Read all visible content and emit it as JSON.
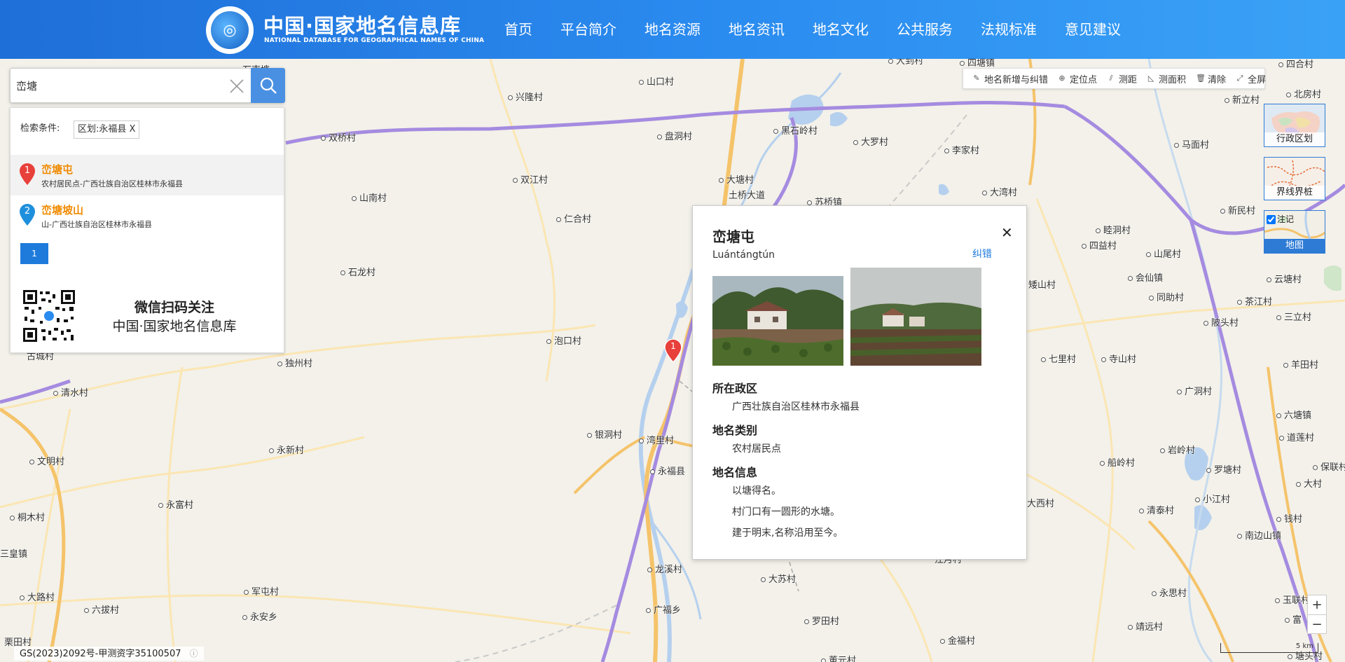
{
  "header": {
    "title": "中国·国家地名信息库",
    "subtitle": "NATIONAL DATABASE FOR GEOGRAPHICAL NAMES OF CHINA",
    "nav": [
      "首页",
      "平台简介",
      "地名资源",
      "地名资讯",
      "地名文化",
      "公共服务",
      "法规标准",
      "意见建议"
    ]
  },
  "search": {
    "value": "峦塘",
    "filter_label": "检索条件:",
    "filter_tag": "区划:永福县 X",
    "results": [
      {
        "index": "1",
        "name": "峦塘屯",
        "desc": "农村居民点-广西壮族自治区桂林市永福县"
      },
      {
        "index": "2",
        "name": "峦塘坡山",
        "desc": "山-广西壮族自治区桂林市永福县"
      }
    ],
    "page": "1",
    "qr_title": "微信扫码关注",
    "qr_sub": "中国·国家地名信息库"
  },
  "toolbar": {
    "items": [
      {
        "label": "地名新增与纠错",
        "icon": "edit-icon"
      },
      {
        "label": "定位点",
        "icon": "locate-icon"
      },
      {
        "label": "测距",
        "icon": "ruler-icon"
      },
      {
        "label": "测面积",
        "icon": "area-icon"
      },
      {
        "label": "清除",
        "icon": "trash-icon"
      },
      {
        "label": "全屏",
        "icon": "fullscreen-icon"
      }
    ]
  },
  "layers": {
    "admin": "行政区划",
    "boundary": "界线界桩",
    "map": "地图",
    "annotation": "注记",
    "annotation_checked": true
  },
  "popup": {
    "title": "峦塘屯",
    "pinyin": "Luántángtún",
    "correct": "纠错",
    "region_head": "所在政区",
    "region": "广西壮族自治区桂林市永福县",
    "type_head": "地名类别",
    "type": "农村居民点",
    "info_head": "地名信息",
    "info": [
      "以塘得名。",
      "村门口有一圆形的水塘。",
      "建于明末,名称沿用至今。"
    ]
  },
  "map": {
    "marker": "1",
    "scale": "5 km",
    "copyright": "GS(2023)2092号-甲测资字35100507",
    "places": [
      {
        "name": "石南塘",
        "style": "plain"
      },
      {
        "name": "大到村",
        "style": "dot"
      },
      {
        "name": "四塘镇",
        "style": "dot"
      },
      {
        "name": "四合村",
        "style": "dot"
      },
      {
        "name": "北房村",
        "style": "dot"
      },
      {
        "name": "山口村",
        "style": "dot"
      },
      {
        "name": "兴隆村",
        "style": "dot"
      },
      {
        "name": "双桥村",
        "style": "dot"
      },
      {
        "name": "盘洞村",
        "style": "dot"
      },
      {
        "name": "黑石岭村",
        "style": "dot"
      },
      {
        "name": "大罗村",
        "style": "dot"
      },
      {
        "name": "李家村",
        "style": "dot"
      },
      {
        "name": "马面村",
        "style": "dot"
      },
      {
        "name": "新立村",
        "style": "dot"
      },
      {
        "name": "双江村",
        "style": "dot"
      },
      {
        "name": "大塘村",
        "style": "dot"
      },
      {
        "name": "土桥大道",
        "style": "plain"
      },
      {
        "name": "苏桥镇",
        "style": "dot"
      },
      {
        "name": "大湾村",
        "style": "dot"
      },
      {
        "name": "山南村",
        "style": "dot"
      },
      {
        "name": "仁合村",
        "style": "dot"
      },
      {
        "name": "新民村",
        "style": "dot"
      },
      {
        "name": "睦洞村",
        "style": "dot"
      },
      {
        "name": "四益村",
        "style": "dot"
      },
      {
        "name": "山尾村",
        "style": "dot"
      },
      {
        "name": "会仙镇",
        "style": "dot"
      },
      {
        "name": "云塘村",
        "style": "dot"
      },
      {
        "name": "石龙村",
        "style": "dot"
      },
      {
        "name": "矮山村",
        "style": "dot"
      },
      {
        "name": "同助村",
        "style": "dot"
      },
      {
        "name": "茶江村",
        "style": "dot"
      },
      {
        "name": "三立村",
        "style": "dot"
      },
      {
        "name": "陂头村",
        "style": "dot"
      },
      {
        "name": "泡口村",
        "style": "dot"
      },
      {
        "name": "古城村",
        "style": "dot"
      },
      {
        "name": "独州村",
        "style": "dot"
      },
      {
        "name": "七里村",
        "style": "dot"
      },
      {
        "name": "寺山村",
        "style": "dot"
      },
      {
        "name": "羊田村",
        "style": "dot"
      },
      {
        "name": "清水村",
        "style": "dot"
      },
      {
        "name": "广洞村",
        "style": "dot"
      },
      {
        "name": "六塘镇",
        "style": "dot"
      },
      {
        "name": "银洞村",
        "style": "dot"
      },
      {
        "name": "湾里村",
        "style": "dot"
      },
      {
        "name": "永新村",
        "style": "dot"
      },
      {
        "name": "道莲村",
        "style": "dot"
      },
      {
        "name": "文明村",
        "style": "dot"
      },
      {
        "name": "永福县",
        "style": "dot"
      },
      {
        "name": "船岭村",
        "style": "dot"
      },
      {
        "name": "岩岭村",
        "style": "dot"
      },
      {
        "name": "罗塘村",
        "style": "dot"
      },
      {
        "name": "保联村",
        "style": "dot"
      },
      {
        "name": "大村",
        "style": "dot"
      },
      {
        "name": "永富村",
        "style": "dot"
      },
      {
        "name": "大西村",
        "style": "plain"
      },
      {
        "name": "小江村",
        "style": "dot"
      },
      {
        "name": "桐木村",
        "style": "dot"
      },
      {
        "name": "清泰村",
        "style": "dot"
      },
      {
        "name": "钱村",
        "style": "dot"
      },
      {
        "name": "南边山镇",
        "style": "dot"
      },
      {
        "name": "三皇镇",
        "style": "plain"
      },
      {
        "name": "江月村",
        "style": "plain"
      },
      {
        "name": "龙溪村",
        "style": "dot"
      },
      {
        "name": "大苏村",
        "style": "dot"
      },
      {
        "name": "大路村",
        "style": "dot"
      },
      {
        "name": "军屯村",
        "style": "dot"
      },
      {
        "name": "永思村",
        "style": "dot"
      },
      {
        "name": "玉联村",
        "style": "dot"
      },
      {
        "name": "六拔村",
        "style": "dot"
      },
      {
        "name": "广福乡",
        "style": "dot"
      },
      {
        "name": "永安乡",
        "style": "dot"
      },
      {
        "name": "罗田村",
        "style": "dot"
      },
      {
        "name": "靖远村",
        "style": "dot"
      },
      {
        "name": "富",
        "style": "dot"
      },
      {
        "name": "栗田村",
        "style": "plain"
      },
      {
        "name": "金福村",
        "style": "dot"
      },
      {
        "name": "董元村",
        "style": "dot"
      },
      {
        "name": "塘头村",
        "style": "dot"
      }
    ]
  },
  "colors": {
    "header": "#2b8cf0",
    "accent": "#1e7bdc",
    "result_title": "#f08a00",
    "highway": "#a58be0",
    "road": "#f5c36a",
    "water": "#b5d0ee"
  }
}
